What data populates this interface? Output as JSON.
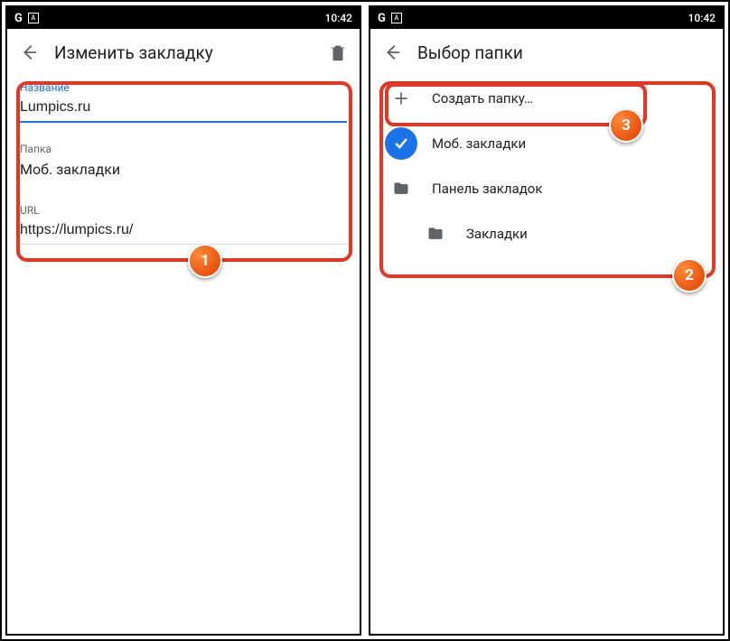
{
  "status": {
    "time": "10:42"
  },
  "left": {
    "title": "Изменить закладку",
    "name_label": "Название",
    "name_value": "Lumpics.ru",
    "folder_label": "Папка",
    "folder_value": "Моб. закладки",
    "url_label": "URL",
    "url_value": "https://lumpics.ru/"
  },
  "right": {
    "title": "Выбор папки",
    "new_folder": "Создать папку…",
    "folders": {
      "mobile": "Моб. закладки",
      "bar": "Панель закладок",
      "bookmarks": "Закладки"
    }
  },
  "badges": {
    "b1": "1",
    "b2": "2",
    "b3": "3"
  }
}
